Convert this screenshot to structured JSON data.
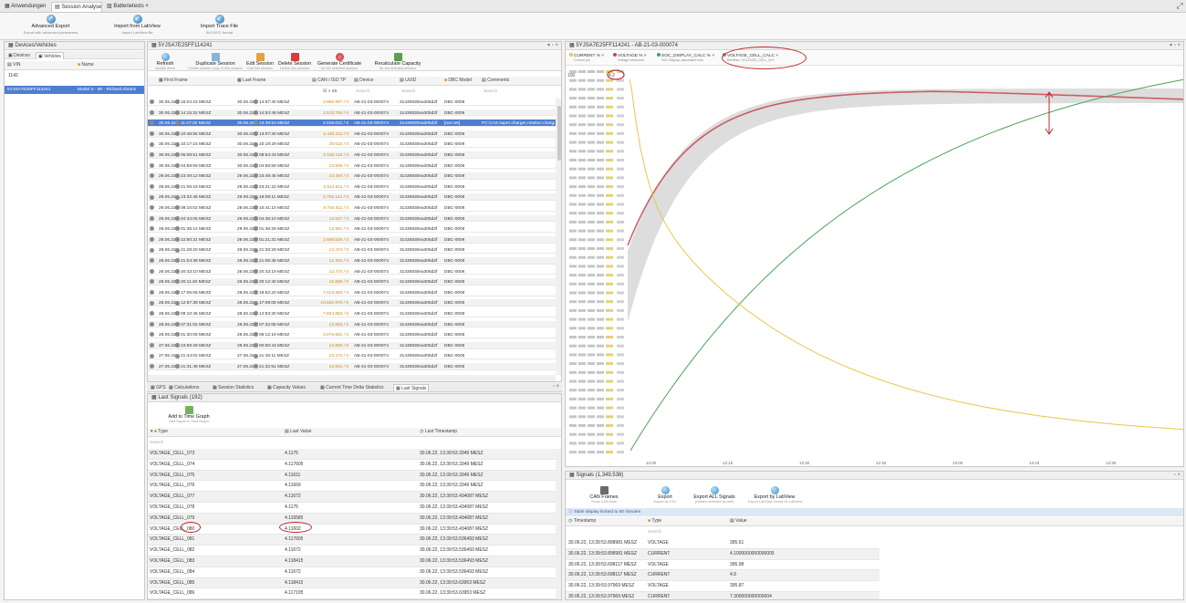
{
  "top_tabs": [
    "Anwendungen",
    "Session Analyse",
    "Batterietests"
  ],
  "ribbon": [
    {
      "label": "Advanced Export",
      "sub": "Export with advanced parameters",
      "icon": "advanced-export-icon"
    },
    {
      "label": "Import from LabView",
      "sub": "Import LabView file",
      "icon": "import-labview-icon"
    },
    {
      "label": "Import Trace File",
      "sub": "BLF/ASC format",
      "icon": "import-trace-icon"
    }
  ],
  "devices": {
    "title": "Devices/Vehicles",
    "tabs": [
      "Devices",
      "Vehicles"
    ],
    "columns": [
      "VIN",
      "Name"
    ],
    "filter": "1142",
    "rows": [
      {
        "vin": "5YJSA7E25FF114241",
        "name": "Model S - 90 - Richard Abrami"
      }
    ]
  },
  "sessions": {
    "title": "5YJSA7E25FF114241",
    "toolbar": [
      {
        "label": "Refresh",
        "sub": "Update items",
        "icon": "refresh-icon"
      },
      {
        "label": "Duplicate Session",
        "sub": "Create another copy of this session",
        "icon": "duplicate-icon"
      },
      {
        "label": "Edit Session",
        "sub": "Edit this session",
        "icon": "edit-icon"
      },
      {
        "label": "Delete Session",
        "sub": "Delete this session",
        "icon": "delete-icon"
      },
      {
        "label": "Generate Certificate",
        "sub": "for the selected session",
        "icon": "certificate-icon"
      },
      {
        "label": "Recalculate Capacity",
        "sub": "for the selected session",
        "icon": "recalculate-icon"
      }
    ],
    "columns": [
      "First Frame",
      "Last Frame",
      "CAN / ISO TP",
      "Device",
      "UUID",
      "DBC Model",
      "Comments"
    ],
    "filters": {
      "count": "> 25",
      "search": "Search"
    },
    "rows": [
      [
        "30.06.22",
        "15:04:23 MESZ",
        "30.06.22",
        "14:57:40 MESZ",
        "3.986.887 / 0",
        "AB-21-03-000074",
        "31430830ea305d2f",
        "DBC-0006",
        ""
      ],
      [
        "30.06.22",
        "14:15:32 MESZ",
        "30.06.22",
        "14:53:48 MESZ",
        "1.515.784 / 0",
        "AB-21-03-000074",
        "31430830ea305d2f",
        "DBC-0006",
        ""
      ],
      [
        "30.06.22",
        "11:47:30 MESZ",
        "30.06.22",
        "13:39:53 MESZ",
        "2.019.021 / 0",
        "AB-21-03-000074",
        "31430830ea305d2f",
        "[not set]",
        "PC:CAS:super:charger,rotation:charge"
      ],
      [
        "30.06.22",
        "10:48:56 MESZ",
        "30.06.22",
        "13:07:30 MESZ",
        "2.440.211 / 0",
        "AB-21-03-000074",
        "31430830ea305d2f",
        "DBC-0006",
        ""
      ],
      [
        "30.06.22",
        "10:17:15 MESZ",
        "30.06.22",
        "10:19:29 MESZ",
        "29.616 / 0",
        "AB-21-03-000074",
        "31430830ea305d2f",
        "DBC-0006",
        ""
      ],
      [
        "30.06.22",
        "05:08:51 MESZ",
        "30.06.22",
        "08:54:43 MESZ",
        "2.155.115 / 0",
        "AB-21-03-000074",
        "31430830ea305d2f",
        "DBC-0006",
        ""
      ],
      [
        "30.06.22",
        "04:59:59 MESZ",
        "30.06.22",
        "04:59:59 MESZ",
        "13.659 / 0",
        "AB-21-03-000074",
        "31430830ea305d2f",
        "DBC-0006",
        ""
      ],
      [
        "29.06.22",
        "23:49:12 MESZ",
        "29.06.22",
        "23:49:45 MESZ",
        "13.494 / 0",
        "AB-21-03-000074",
        "31430830ea305d2f",
        "DBC-0006",
        ""
      ],
      [
        "29.06.22",
        "21:05:18 MESZ",
        "29.06.22",
        "23:21:22 MESZ",
        "2.514.611 / 0",
        "AB-21-03-000074",
        "31430830ea305d2f",
        "DBC-0006",
        ""
      ],
      [
        "29.06.22",
        "13:32:45 MESZ",
        "29.06.22",
        "18:08:11 MESZ",
        "3.792.141 / 0",
        "AB-21-03-000074",
        "31430830ea305d2f",
        "DBC-0006",
        ""
      ],
      [
        "29.06.22",
        "09:10:02 MESZ",
        "29.06.22",
        "10:41:10 MESZ",
        "9.754.511 / 0",
        "AB-21-03-000074",
        "31430830ea305d2f",
        "DBC-0006",
        ""
      ],
      [
        "29.06.22",
        "04:34:05 MESZ",
        "29.06.22",
        "04:35:10 MESZ",
        "13.647 / 0",
        "AB-21-03-000074",
        "31430830ea305d2f",
        "DBC-0006",
        ""
      ],
      [
        "29.06.22",
        "01:35:14 MESZ",
        "29.06.22",
        "01:36:25 MESZ",
        "13.861 / 0",
        "AB-21-03-000074",
        "31430830ea305d2f",
        "DBC-0006",
        ""
      ],
      [
        "28.06.22",
        "22:50:31 MESZ",
        "29.06.22",
        "01:21:31 MESZ",
        "2.588.526 / 0",
        "AB-21-03-000074",
        "31430830ea305d2f",
        "DBC-0006",
        ""
      ],
      [
        "28.06.22",
        "21:28:20 MESZ",
        "28.06.22",
        "21:28:29 MESZ",
        "13.474 / 0",
        "AB-21-03-000074",
        "31430830ea305d2f",
        "DBC-0006",
        ""
      ],
      [
        "28.06.22",
        "21:04:38 MESZ",
        "28.06.22",
        "21:05:38 MESZ",
        "12.304 / 0",
        "AB-21-03-000074",
        "31430830ea305d2f",
        "DBC-0006",
        ""
      ],
      [
        "28.06.22",
        "20:43:10 MESZ",
        "28.06.22",
        "20:43:19 MESZ",
        "13.474 / 0",
        "AB-21-03-000074",
        "31430830ea305d2f",
        "DBC-0006",
        ""
      ],
      [
        "28.06.22",
        "20:11:40 MESZ",
        "28.06.22",
        "20:12:40 MESZ",
        "15.659 / 0",
        "AB-21-03-000074",
        "31430830ea305d2f",
        "DBC-0006",
        ""
      ],
      [
        "28.06.22",
        "17:05:05 MESZ",
        "28.06.22",
        "19:52:20 MESZ",
        "7.013.383 / 0",
        "AB-21-03-000074",
        "31430830ea305d2f",
        "DBC-0006",
        ""
      ],
      [
        "28.06.22",
        "12:57:38 MESZ",
        "28.06.22",
        "17:09:05 MESZ",
        "10.682.870 / 0",
        "AB-21-03-000074",
        "31430830ea305d2f",
        "DBC-0006",
        ""
      ],
      [
        "28.06.22",
        "09:10:46 MESZ",
        "28.06.22",
        "12:53:30 MESZ",
        "7.824.863 / 0",
        "AB-21-03-000074",
        "31430830ea305d2f",
        "DBC-0006",
        ""
      ],
      [
        "28.06.22",
        "07:31:02 MESZ",
        "28.06.22",
        "07:32:08 MESZ",
        "13.883 / 0",
        "AB-21-03-000074",
        "31430830ea305d2f",
        "DBC-0006",
        ""
      ],
      [
        "28.06.22",
        "01:30:09 MESZ",
        "28.06.22",
        "05:12:19 MESZ",
        "3.076.881 / 0",
        "AB-21-03-000074",
        "31430830ea305d2f",
        "DBC-0006",
        ""
      ],
      [
        "27.06.22",
        "23:59:29 MESZ",
        "28.06.22",
        "00:00:43 MESZ",
        "13.650 / 0",
        "AB-21-03-000074",
        "31430830ea305d2f",
        "DBC-0006",
        ""
      ],
      [
        "27.06.22",
        "21:44:02 MESZ",
        "27.06.22",
        "21:45:11 MESZ",
        "13.474 / 0",
        "AB-21-03-000074",
        "31430830ea305d2f",
        "DBC-0006",
        ""
      ],
      [
        "27.06.22",
        "21:31:48 MESZ",
        "27.06.22",
        "21:32:51 MESZ",
        "13.661 / 0",
        "AB-21-03-000074",
        "31430830ea305d2f",
        "DBC-0006",
        ""
      ]
    ]
  },
  "bottom_tabs": [
    "GPS",
    "Calculations",
    "Session Statistics",
    "Capacity Values",
    "Current Time Delta Statistics",
    "Last Signals"
  ],
  "last_signals": {
    "title": "Last Signals (192)",
    "add_button": {
      "label": "Add to Time Graph",
      "sub": "Add Signal to Time Graph"
    },
    "columns": [
      "Type",
      "Last Value",
      "Last Timestamp"
    ],
    "search": "Search",
    "rows": [
      [
        "VOLTAGE_CELL_073",
        "4.1175",
        "30.06.22, 13:39:53.3349 MESZ"
      ],
      [
        "VOLTAGE_CELL_074",
        "4.117605",
        "30.06.22, 13:39:53.3349 MESZ"
      ],
      [
        "VOLTAGE_CELL_075",
        "4.11611",
        "30.06.22, 13:39:53.3349 MESZ"
      ],
      [
        "VOLTAGE_CELL_076",
        "4.11669",
        "30.06.22, 13:39:53.3349 MESZ"
      ],
      [
        "VOLTAGE_CELL_077",
        "4.11672",
        "30.06.22, 13:39:53.434087 MESZ"
      ],
      [
        "VOLTAGE_CELL_078",
        "4.1175",
        "30.06.22, 13:39:53.434087 MESZ"
      ],
      [
        "VOLTAGE_CELL_079",
        "4.116585",
        "30.06.22, 13:39:53.434087 MESZ"
      ],
      [
        "VOLTAGE_CELL_080",
        "4.11602",
        "30.06.22, 13:39:53.434087 MESZ"
      ],
      [
        "VOLTAGE_CELL_081",
        "4.117605",
        "30.06.22, 13:39:53.536493 MESZ"
      ],
      [
        "VOLTAGE_CELL_082",
        "4.11672",
        "30.06.22, 13:39:53.536493 MESZ"
      ],
      [
        "VOLTAGE_CELL_083",
        "4.118415",
        "30.06.22, 13:39:53.536493 MESZ"
      ],
      [
        "VOLTAGE_CELL_084",
        "4.11672",
        "30.06.22, 13:39:53.536493 MESZ"
      ],
      [
        "VOLTAGE_CELL_085",
        "4.118415",
        "30.06.22, 13:39:53.63953 MESZ"
      ],
      [
        "VOLTAGE_CELL_086",
        "4.117195",
        "30.06.22, 13:39:53.63953 MESZ"
      ]
    ]
  },
  "graph": {
    "title": "5YJSA7E25FF114241 - AB-21-03-000074",
    "legend": [
      {
        "name": "CURRENT % ",
        "sub": "Current (A)",
        "color": "#e6c84a"
      },
      {
        "name": "VOLTAGE % ",
        "sub": "Voltage measured",
        "color": "#c8474f"
      },
      {
        "name": "SOC_DISPLAY_CALC % ",
        "sub": "SoC Display, calculated from",
        "color": "#4aa35a"
      },
      {
        "name": "VOLTAGE_CELL_CALC ",
        "sub": "Min/Max: VOLTAGE_CELL_0XX",
        "color": "#8a8a8a"
      }
    ],
    "xticks": [
      "12:00",
      "12:15",
      "12:30",
      "12:45",
      "13:00",
      "13:15",
      "13:30"
    ],
    "axis1_top": "100",
    "axis2_top": "4.2"
  },
  "signals": {
    "title": "Signals (1,349,538)",
    "buttons": [
      {
        "label": "CAN Frames",
        "sub": "Show CAN Data"
      },
      {
        "label": "Export",
        "sub": "Export as CSV"
      },
      {
        "label": "Export ALL Signals",
        "sub": "(Hidden selected as well)"
      },
      {
        "label": "Export by LabView",
        "sub": "Export LabView format for LabView"
      }
    ],
    "note": "Table display limited to 60 minutes",
    "columns": [
      "Timestamp",
      "Type",
      "Value"
    ],
    "search": "Search",
    "rows": [
      [
        "30.06.22, 13:39:53.898981 MESZ",
        "VOLTAGE",
        "395.61"
      ],
      [
        "30.06.22, 13:39:53.898981 MESZ",
        "CURRENT",
        "4.1000000000000005"
      ],
      [
        "30.06.22, 13:39:53.698117 MESZ",
        "VOLTAGE",
        "395.98"
      ],
      [
        "30.06.22, 13:39:53.698117 MESZ",
        "CURRENT",
        "4.9"
      ],
      [
        "30.06.22, 13:39:53.97969 MESZ",
        "VOLTAGE",
        "395.87"
      ],
      [
        "30.06.22, 13:39:53.97969 MESZ",
        "CURRENT",
        "7.300000000000004"
      ]
    ]
  },
  "colors": {
    "selected": "#4d7ed0",
    "current": "#e6c84a",
    "voltage": "#c8474f",
    "soc": "#4aa35a",
    "cells": "#8a8a8a",
    "annotation": "#c0282c"
  }
}
